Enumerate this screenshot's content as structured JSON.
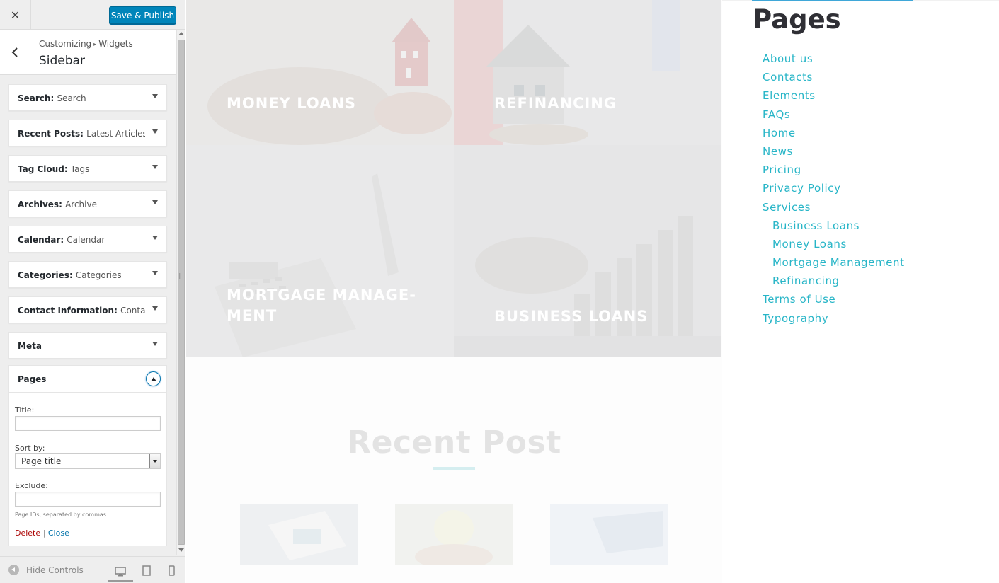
{
  "customizer": {
    "publish_label": "Save & Publish",
    "breadcrumb": [
      "Customizing",
      "Widgets"
    ],
    "panel_title": "Sidebar",
    "widgets": [
      {
        "type": "Search",
        "title": "Search"
      },
      {
        "type": "Recent Posts",
        "title": "Latest Articles"
      },
      {
        "type": "Tag Cloud",
        "title": "Tags"
      },
      {
        "type": "Archives",
        "title": "Archive"
      },
      {
        "type": "Calendar",
        "title": "Calendar"
      },
      {
        "type": "Categories",
        "title": "Categories"
      },
      {
        "type": "Contact Information",
        "title": "Contact..."
      },
      {
        "type": "Meta",
        "title": ""
      }
    ],
    "pages_widget": {
      "name": "Pages",
      "title_label": "Title:",
      "title_value": "",
      "sort_label": "Sort by:",
      "sort_value": "Page title",
      "exclude_label": "Exclude:",
      "exclude_value": "",
      "exclude_help": "Page IDs, separated by commas.",
      "delete_label": "Delete",
      "separator": "|",
      "close_label": "Close"
    },
    "footer": {
      "hide_controls_label": "Hide Controls",
      "devices": [
        "desktop-icon",
        "tablet-icon",
        "mobile-icon"
      ]
    }
  },
  "preview": {
    "services": [
      {
        "line1": "MONEY LOANS",
        "line2": ""
      },
      {
        "line1": "REFINANCING",
        "line2": ""
      },
      {
        "line1": "MORTGAGE MANAGE-",
        "line2": "MENT"
      },
      {
        "line1": "BUSINESS LOANS",
        "line2": ""
      }
    ],
    "recent_post_title": "Recent Post"
  },
  "sidebar": {
    "heading": "Pages",
    "pages": [
      {
        "label": "About us",
        "child": false
      },
      {
        "label": "Contacts",
        "child": false
      },
      {
        "label": "Elements",
        "child": false
      },
      {
        "label": "FAQs",
        "child": false
      },
      {
        "label": "Home",
        "child": false
      },
      {
        "label": "News",
        "child": false
      },
      {
        "label": "Pricing",
        "child": false
      },
      {
        "label": "Privacy Policy",
        "child": false
      },
      {
        "label": "Services",
        "child": false
      },
      {
        "label": "Business Loans",
        "child": true
      },
      {
        "label": "Money Loans",
        "child": true
      },
      {
        "label": "Mortgage Management",
        "child": true
      },
      {
        "label": "Refinancing",
        "child": true
      },
      {
        "label": "Terms of Use",
        "child": false
      },
      {
        "label": "Typography",
        "child": false
      }
    ]
  },
  "colors": {
    "publish": "#0085ba",
    "link": "#27b5c7",
    "delete": "#aa0000",
    "close": "#0073aa",
    "heading": "#2f2f35"
  }
}
